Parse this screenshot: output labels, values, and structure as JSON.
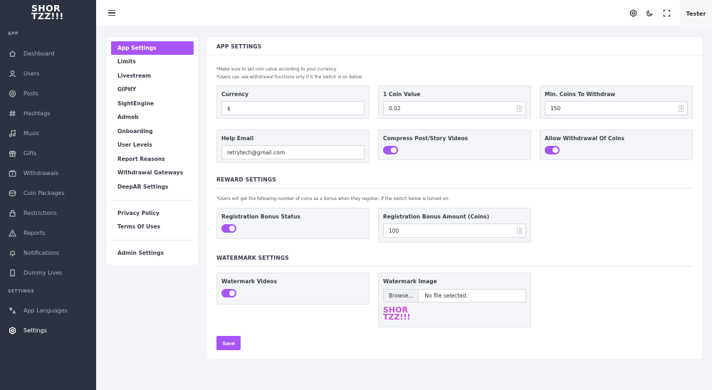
{
  "brand": {
    "logo_line1": "SHOR",
    "logo_line2": "TZZ!!!"
  },
  "sidebar": {
    "section_app": "APP",
    "section_settings": "SETTINGS",
    "items": [
      {
        "label": "Dashboard",
        "icon": "home-icon"
      },
      {
        "label": "Users",
        "icon": "user-icon"
      },
      {
        "label": "Posts",
        "icon": "posts-icon"
      },
      {
        "label": "Hashtags",
        "icon": "hashtag-icon"
      },
      {
        "label": "Music",
        "icon": "music-icon"
      },
      {
        "label": "Gifts",
        "icon": "gift-icon"
      },
      {
        "label": "Withdrawals",
        "icon": "wallet-icon"
      },
      {
        "label": "Coin Packages",
        "icon": "coins-icon"
      },
      {
        "label": "Restrictions",
        "icon": "lock-icon"
      },
      {
        "label": "Reports",
        "icon": "alert-icon"
      },
      {
        "label": "Notifications",
        "icon": "bell-icon"
      },
      {
        "label": "Dummy Lives",
        "icon": "phone-icon"
      }
    ],
    "settings_items": [
      {
        "label": "App Languages",
        "icon": "translate-icon"
      },
      {
        "label": "Settings",
        "icon": "gear-icon"
      }
    ]
  },
  "topbar": {
    "user": "Tester"
  },
  "settings_nav": {
    "items": [
      "App Settings",
      "Limits",
      "Livestream",
      "GIPHY",
      "SightEngine",
      "Admob",
      "Onboarding",
      "User Levels",
      "Report Reasons",
      "Withdrawal Gateways",
      "DeepAR Settings"
    ],
    "items2": [
      "Privacy Policy",
      "Terms Of Uses"
    ],
    "items3": [
      "Admin Settings"
    ]
  },
  "app_settings": {
    "title": "APP SETTINGS",
    "note1": "*Make sure to set coin value according to your currency.",
    "note2": "*Users can use withdrawal functions only if it the switch is on below.",
    "currency_label": "Currency",
    "currency_value": "$",
    "coin_value_label": "1 Coin Value",
    "coin_value": "0.02",
    "min_coins_label": "Min. Coins To Withdraw",
    "min_coins_value": "150",
    "help_email_label": "Help Email",
    "help_email_value": "retrytech@gmail.com",
    "compress_label": "Compress Post/Story Videos",
    "compress_on": true,
    "allow_withdrawal_label": "Allow Withdrawal Of Coins",
    "allow_withdrawal_on": true
  },
  "reward_settings": {
    "title": "REWARD SETTINGS",
    "note": "*Users will get the following number of coins as a bonus when they register, if the switch below is turned on.",
    "status_label": "Registration Bonus Status",
    "status_on": true,
    "amount_label": "Registration Bonus Amount (Coins)",
    "amount_value": "100"
  },
  "watermark_settings": {
    "title": "WATERMARK SETTINGS",
    "videos_label": "Watermark Videos",
    "videos_on": true,
    "image_label": "Watermark Image",
    "browse_label": "Browse...",
    "file_status": "No file selected."
  },
  "save_label": "Save",
  "colors": {
    "accent": "#a855f7",
    "sidebar_bg": "#2c323f"
  }
}
